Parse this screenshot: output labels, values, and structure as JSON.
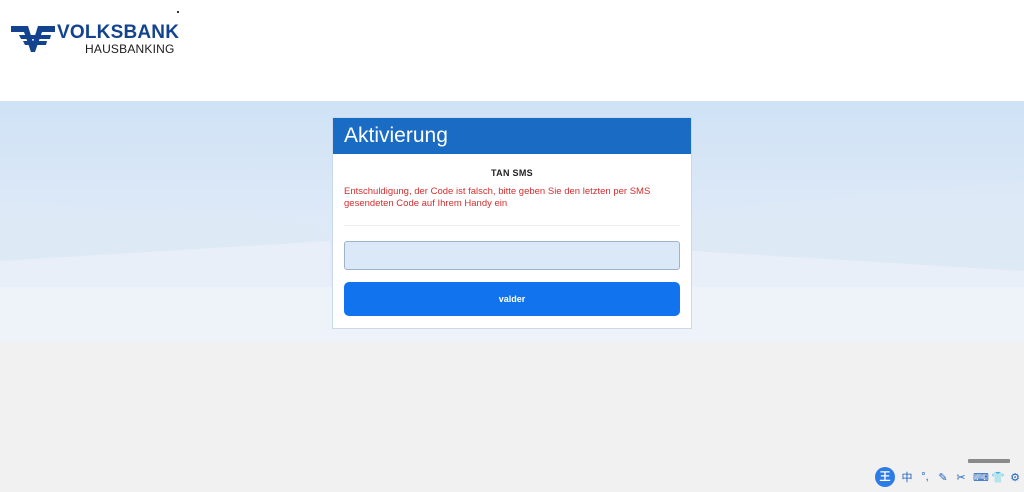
{
  "brand": {
    "name": "VOLKSBANK",
    "subtitle": "HAUSBANKING",
    "color": "#13438f"
  },
  "card": {
    "title": "Aktivierung",
    "subtitle": "TAN SMS",
    "error": "Entschuldigung, der Code ist falsch, bitte geben Sie den letzten per SMS gesendeten Code auf Ihrem Handy ein",
    "input_value": "",
    "submit_label": "valder",
    "header_color": "#1a6bc4",
    "button_color": "#1173ee",
    "error_color": "#d32f2f"
  },
  "ime_toolbar": {
    "logo": "王",
    "items": [
      {
        "glyph": "中",
        "icon": "chinese-mode-icon"
      },
      {
        "glyph": "°,",
        "icon": "punctuation-icon"
      },
      {
        "glyph": "✎",
        "icon": "handwrite-icon"
      },
      {
        "glyph": "✂",
        "icon": "scissors-icon"
      },
      {
        "glyph": "⌨",
        "icon": "keyboard-icon"
      },
      {
        "glyph": "👕",
        "icon": "skin-icon"
      },
      {
        "glyph": "⚙",
        "icon": "gear-icon"
      }
    ]
  }
}
